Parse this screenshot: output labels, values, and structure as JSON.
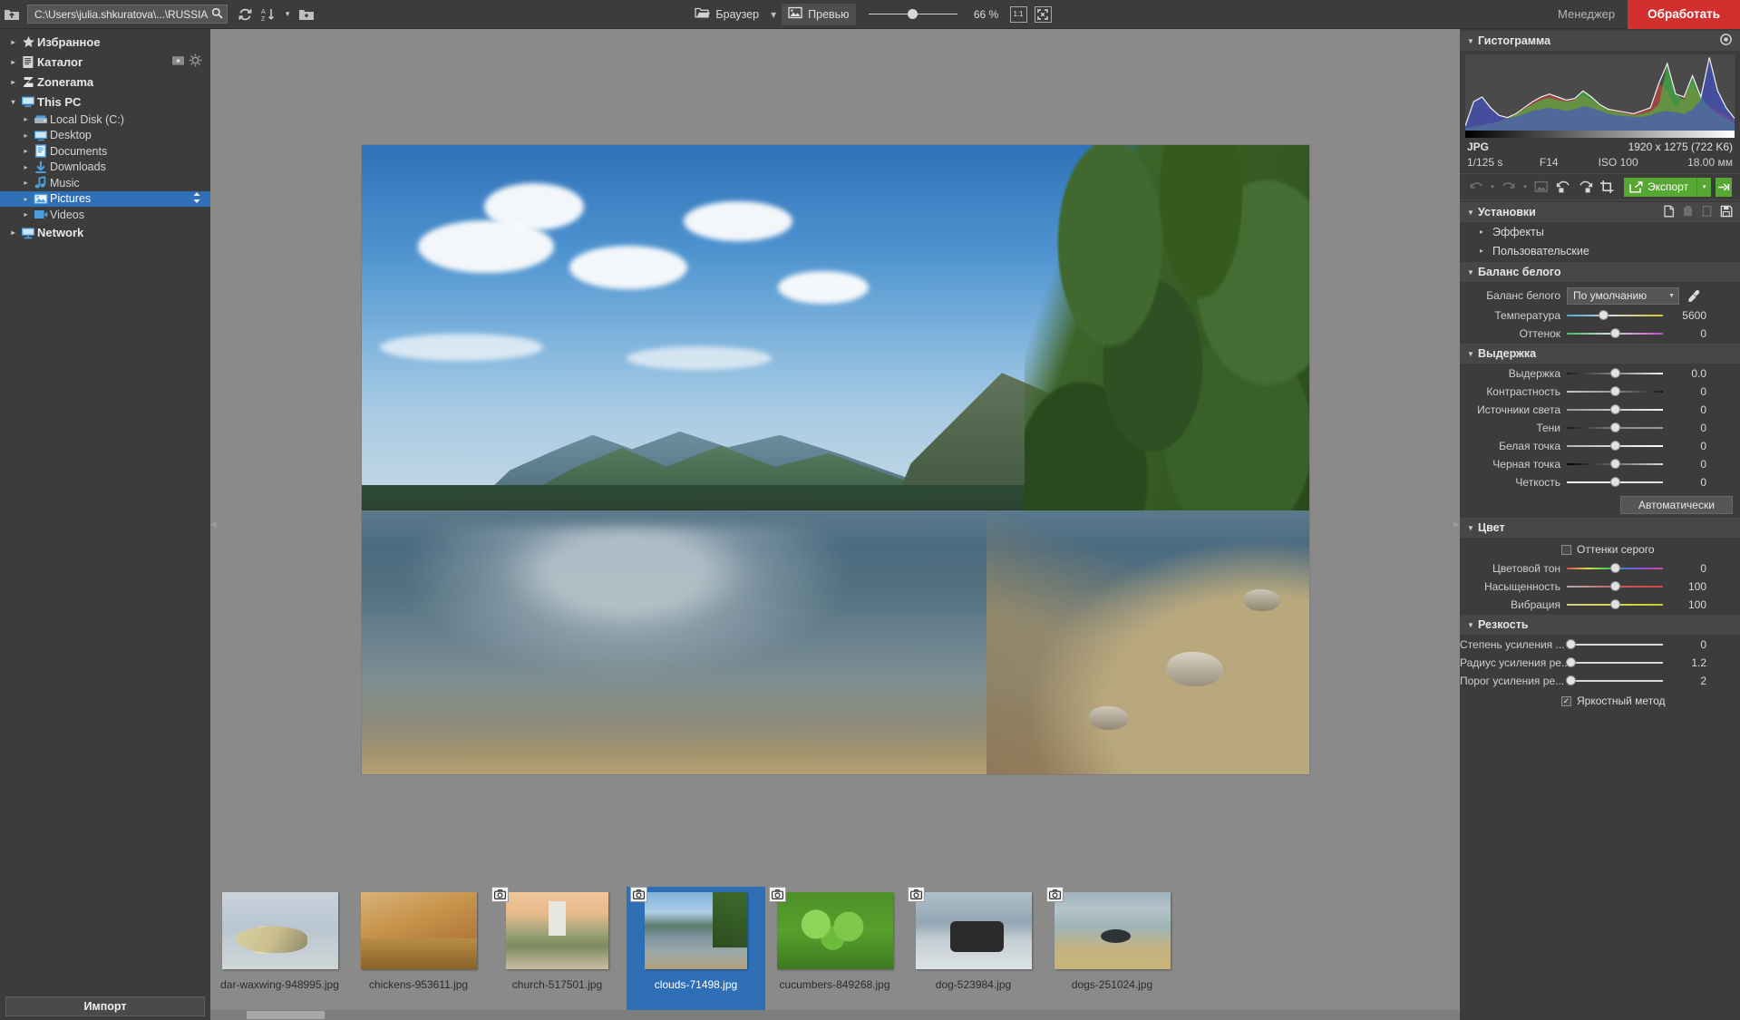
{
  "topbar": {
    "up_icon": "folder-up-icon",
    "path_value": "C:\\Users\\julia.shkuratova\\...\\RUSSIA",
    "search_icon": "search-icon",
    "refresh_icon": "refresh-icon",
    "sort_icon": "sort-az-icon",
    "sort_caret": "▾",
    "newfolder_icon": "new-folder-icon",
    "browser_label": "Браузер",
    "browser_icon": "folder-open-icon",
    "browser_caret": "▾",
    "preview_label": "Превью",
    "preview_icon": "image-icon",
    "zoom_value": "66 %",
    "one_to_one_label": "1:1",
    "fit_icon": "fit-screen-icon",
    "manager_label": "Менеджер",
    "develop_label": "Обработать"
  },
  "sidebar": {
    "items": [
      {
        "label": "Избранное",
        "icon": "star-icon",
        "level": 0,
        "arrow": "▸",
        "selected": false
      },
      {
        "label": "Каталог",
        "icon": "catalog-icon",
        "level": 0,
        "arrow": "▸",
        "selected": false,
        "tools": [
          "add-folder-icon",
          "gear-icon"
        ]
      },
      {
        "label": "Zonerama",
        "icon": "zonerama-icon",
        "level": 0,
        "arrow": "▸",
        "selected": false
      },
      {
        "label": "This PC",
        "icon": "computer-icon",
        "level": 0,
        "arrow": "▾",
        "selected": false
      },
      {
        "label": "Local Disk (C:)",
        "icon": "drive-icon",
        "level": 1,
        "arrow": "▸",
        "selected": false
      },
      {
        "label": "Desktop",
        "icon": "desktop-icon",
        "level": 1,
        "arrow": "▸",
        "selected": false
      },
      {
        "label": "Documents",
        "icon": "documents-icon",
        "level": 1,
        "arrow": "▸",
        "selected": false
      },
      {
        "label": "Downloads",
        "icon": "downloads-icon",
        "level": 1,
        "arrow": "▸",
        "selected": false
      },
      {
        "label": "Music",
        "icon": "music-icon",
        "level": 1,
        "arrow": "▸",
        "selected": false
      },
      {
        "label": "Pictures",
        "icon": "pictures-icon",
        "level": 1,
        "arrow": "▸",
        "selected": true,
        "tools": [
          "updown-icon"
        ]
      },
      {
        "label": "Videos",
        "icon": "videos-icon",
        "level": 1,
        "arrow": "▸",
        "selected": false
      },
      {
        "label": "Network",
        "icon": "network-icon",
        "level": 0,
        "arrow": "▸",
        "selected": false
      }
    ],
    "import_label": "Импорт"
  },
  "filmstrip": {
    "items": [
      {
        "caption": "dar-waxwing-948995.jpg",
        "art": "art-waxwing",
        "badge": false,
        "selected": false,
        "wide": true
      },
      {
        "caption": "chickens-953611.jpg",
        "art": "art-chickens",
        "badge": false,
        "selected": false,
        "wide": true
      },
      {
        "caption": "church-517501.jpg",
        "art": "art-church",
        "badge": true,
        "selected": false,
        "wide": false
      },
      {
        "caption": "clouds-71498.jpg",
        "art": "art-clouds",
        "badge": true,
        "selected": true,
        "wide": false
      },
      {
        "caption": "cucumbers-849268.jpg",
        "art": "art-cucumbers",
        "badge": true,
        "selected": false,
        "wide": true
      },
      {
        "caption": "dog-523984.jpg",
        "art": "art-dog",
        "badge": true,
        "selected": false,
        "wide": true
      },
      {
        "caption": "dogs-251024.jpg",
        "art": "art-dogs",
        "badge": true,
        "selected": false,
        "wide": true
      }
    ]
  },
  "rightpanel": {
    "histogram": {
      "title": "Гистограмма",
      "settings_icon": "histogram-settings-icon"
    },
    "fileinfo": {
      "format": "JPG",
      "dimensions": "1920 x 1275 (722 K6)",
      "shutter": "1/125 s",
      "aperture": "F14",
      "iso": "ISO 100",
      "focal": "18.00 мм"
    },
    "toolbar": {
      "undo_icon": "undo-icon",
      "undo_caret": "▾",
      "redo_icon": "redo-icon",
      "redo_caret": "▾",
      "compare_icon": "compare-icon",
      "rotate_left_icon": "rotate-left-icon",
      "rotate_right_icon": "rotate-right-icon",
      "crop_icon": "crop-icon",
      "export_label": "Экспорт",
      "export_icon": "export-icon",
      "export_caret": "▾",
      "next_icon": "next-image-icon"
    },
    "presets": {
      "title": "Установки",
      "tools": [
        "copy-settings-icon",
        "paste-settings-icon",
        "reset-settings-icon",
        "save-settings-icon"
      ],
      "sub": [
        {
          "label": "Эффекты",
          "arrow": "▸"
        },
        {
          "label": "Пользовательские",
          "arrow": "▸"
        }
      ]
    },
    "whitebalance": {
      "title": "Баланс белого",
      "mode_label": "Баланс белого",
      "mode_value": "По умолчанию",
      "pipette_icon": "eyedropper-icon",
      "sliders": [
        {
          "label": "Температура",
          "value": "5600",
          "pos": 38,
          "grad": "linear-gradient(90deg,#4ea8d8 0%, #d8d8d8 48%, #d8c22e 100%)"
        },
        {
          "label": "Оттенок",
          "value": "0",
          "pos": 50,
          "grad": "linear-gradient(90deg,#49b36a 0%, #d8d8d8 45%, #c24ed0 100%)"
        }
      ]
    },
    "exposure": {
      "title": "Выдержка",
      "sliders": [
        {
          "label": "Выдержка",
          "value": "0.0",
          "pos": 50,
          "grad": "linear-gradient(90deg,#1a1a1a 0%, #f2f2f2 100%)"
        },
        {
          "label": "Контрастность",
          "value": "0",
          "pos": 50,
          "grad": "linear-gradient(90deg,#c8c8c8 0%, #9e9e9e 42%, #1a1a1a 100%)"
        },
        {
          "label": "Источники света",
          "value": "0",
          "pos": 50,
          "grad": "linear-gradient(90deg,#9a9a9a 0%, #f4f4f4 100%)"
        },
        {
          "label": "Тени",
          "value": "0",
          "pos": 50,
          "grad": "linear-gradient(90deg,#141414 0%, #8a8a8a 52%, #9a9a9a 100%)"
        },
        {
          "label": "Белая точка",
          "value": "0",
          "pos": 50,
          "grad": "linear-gradient(90deg,#b4b4b4 0%, #ffffff 100%)"
        },
        {
          "label": "Черная точка",
          "value": "0",
          "pos": 50,
          "grad": "linear-gradient(90deg,#000000 0%, #d8d8d8 100%)"
        },
        {
          "label": "Четкость",
          "value": "0",
          "pos": 50,
          "grad": "linear-gradient(90deg,#f2f2f2 0%, #e0e0e0 100%)"
        }
      ],
      "auto_label": "Автоматически"
    },
    "color": {
      "title": "Цвет",
      "grayscale_label": "Оттенки серого",
      "grayscale_checked": false,
      "sliders": [
        {
          "label": "Цветовой тон",
          "value": "0",
          "pos": 50,
          "grad": "linear-gradient(90deg,#d84a4a 0%, #d8d84a 22%, #4ad84a 40%, #4a6ed8 62%, #a04ad8 82%, #d84a9a 100%)"
        },
        {
          "label": "Насыщенность",
          "value": "100",
          "pos": 50,
          "grad": "linear-gradient(90deg,#b0b0b0 0%, #c85a5a 55%, #d84040 100%)"
        },
        {
          "label": "Вибрация",
          "value": "100",
          "pos": 50,
          "grad": "linear-gradient(90deg,#cfcf8a 0%, #d8d84a 55%, #c8c830 100%)"
        }
      ]
    },
    "sharpness": {
      "title": "Резкость",
      "sliders": [
        {
          "label": "Степень усиления ...",
          "value": "0",
          "pos": 4,
          "grad": "linear-gradient(90deg,#d8d8d8 0%, #d8d8d8 100%)"
        },
        {
          "label": "Радиус усиления ре...",
          "value": "1.2",
          "pos": 4,
          "grad": "linear-gradient(90deg,#d8d8d8 0%, #d8d8d8 100%)"
        },
        {
          "label": "Порог усиления ре...",
          "value": "2",
          "pos": 4,
          "grad": "linear-gradient(90deg,#d8d8d8 0%, #d8d8d8 100%)"
        }
      ],
      "luminance_label": "Яркостный метод",
      "luminance_checked": true
    }
  },
  "chart_data": {
    "type": "area",
    "title": "Гистограмма",
    "xlabel": "",
    "ylabel": "",
    "x": [
      0,
      8,
      16,
      24,
      32,
      40,
      48,
      56,
      64,
      72,
      80,
      88,
      96,
      104,
      112,
      120,
      128,
      136,
      144,
      152,
      160,
      168,
      176,
      184,
      192,
      200,
      208,
      216,
      224,
      232,
      240,
      248,
      255
    ],
    "series": [
      {
        "name": "red",
        "color": "#d04040",
        "values": [
          4,
          6,
          8,
          10,
          13,
          17,
          22,
          30,
          38,
          44,
          48,
          44,
          40,
          42,
          46,
          40,
          33,
          28,
          26,
          24,
          22,
          26,
          30,
          62,
          52,
          30,
          44,
          62,
          40,
          32,
          26,
          20,
          14
        ]
      },
      {
        "name": "green",
        "color": "#40c040",
        "values": [
          3,
          5,
          7,
          9,
          12,
          16,
          21,
          28,
          35,
          40,
          43,
          40,
          38,
          40,
          52,
          44,
          34,
          27,
          24,
          22,
          20,
          22,
          25,
          34,
          88,
          48,
          40,
          72,
          44,
          30,
          22,
          16,
          10
        ]
      },
      {
        "name": "blue",
        "color": "#4050d0",
        "values": [
          6,
          38,
          44,
          30,
          20,
          16,
          18,
          22,
          26,
          28,
          30,
          28,
          26,
          28,
          32,
          30,
          26,
          22,
          20,
          19,
          18,
          18,
          20,
          24,
          26,
          24,
          22,
          28,
          40,
          96,
          52,
          30,
          16
        ]
      }
    ],
    "legend": "none",
    "grid": false
  }
}
